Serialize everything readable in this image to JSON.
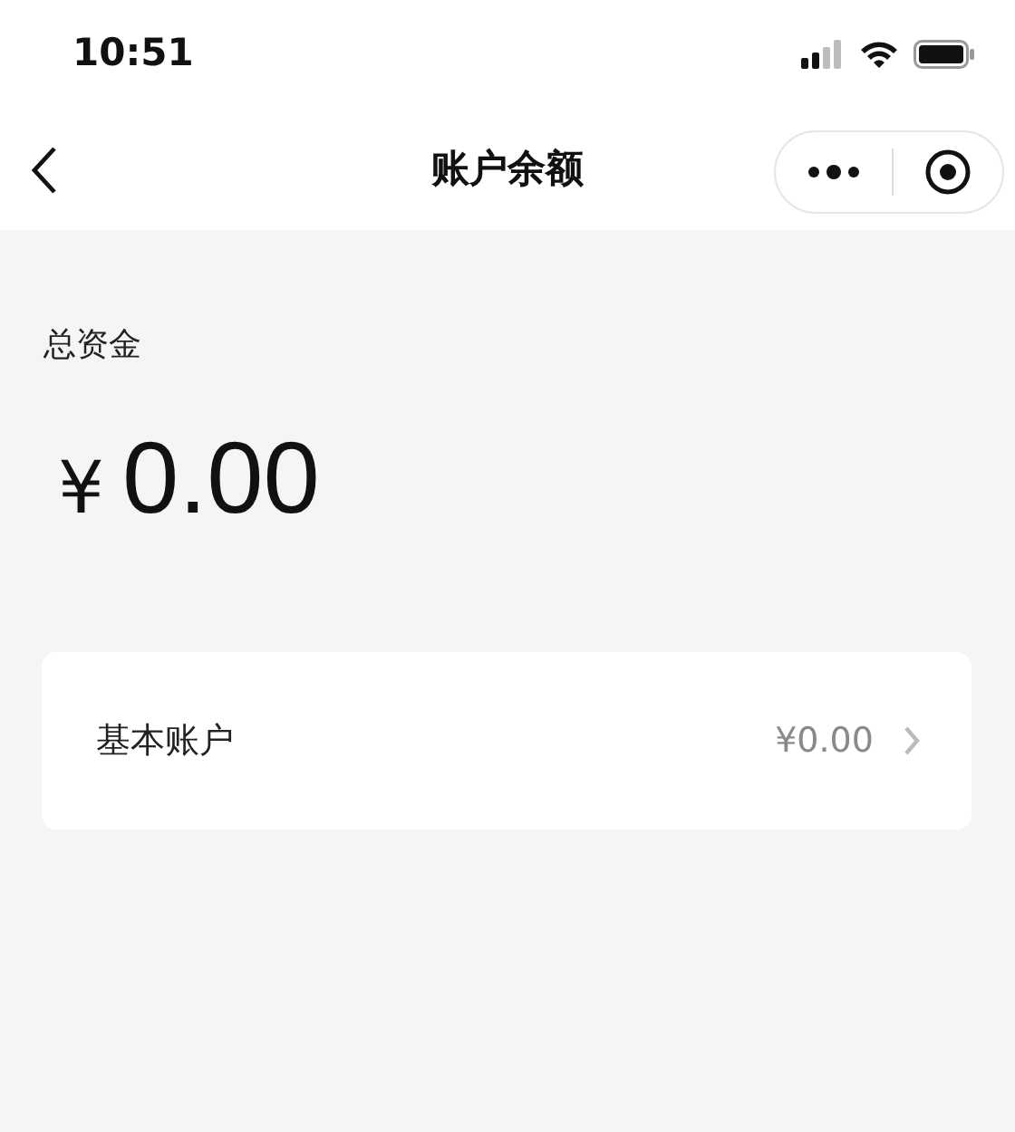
{
  "status_bar": {
    "time": "10:51"
  },
  "nav": {
    "title": "账户余额"
  },
  "total": {
    "label": "总资金",
    "currency": "¥",
    "amount": "0.00"
  },
  "accounts": [
    {
      "name": "基本账户",
      "balance": "¥0.00"
    }
  ]
}
